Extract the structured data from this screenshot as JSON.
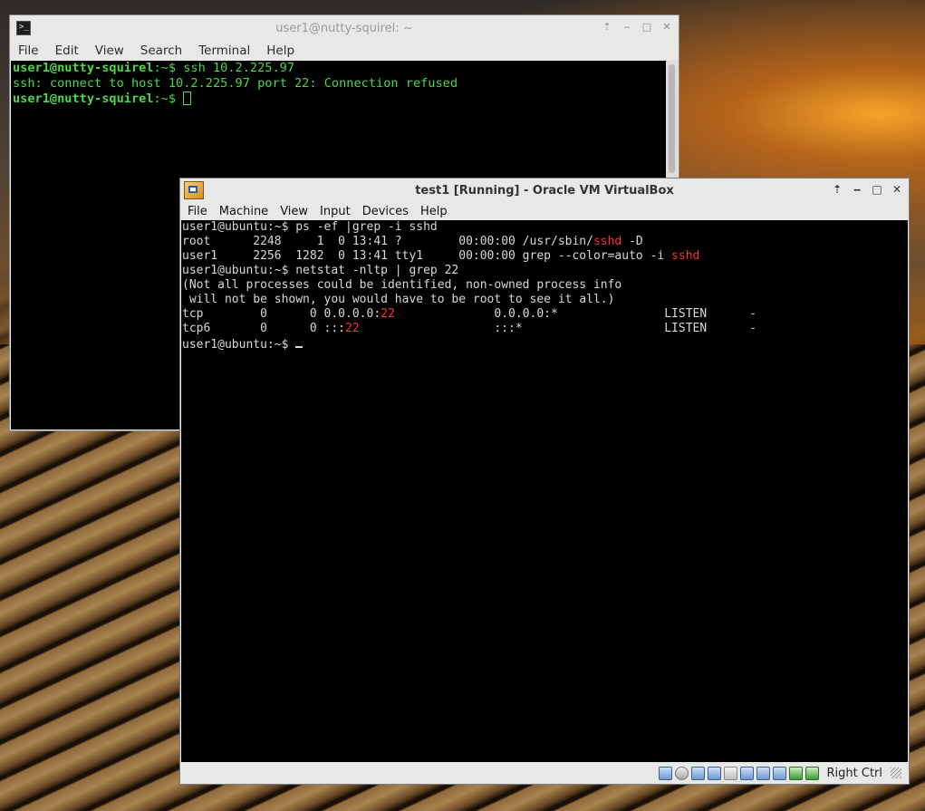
{
  "terminal": {
    "title": "user1@nutty-squirel: ~",
    "menu": [
      "File",
      "Edit",
      "View",
      "Search",
      "Terminal",
      "Help"
    ],
    "lines": [
      {
        "prompt": "user1@nutty-squirel",
        "path": ":~$",
        "cmd": " ssh 10.2.225.97"
      },
      {
        "text": "ssh: connect to host 10.2.225.97 port 22: Connection refused"
      },
      {
        "prompt": "user1@nutty-squirel",
        "path": ":~$",
        "cmd": " "
      }
    ]
  },
  "vbox": {
    "title": "test1 [Running] - Oracle VM VirtualBox",
    "menu": [
      "File",
      "Machine",
      "View",
      "Input",
      "Devices",
      "Help"
    ],
    "host_key": "Right Ctrl",
    "status_icons": [
      "hard-disk-icon",
      "optical-drive-icon",
      "network-icon",
      "usb-icon",
      "shared-folders-icon",
      "display-icon",
      "video-capture-icon",
      "mouse-integration-icon",
      "cpu-icon",
      "host-key-icon"
    ]
  },
  "vm_console": {
    "l1": "user1@ubuntu:~$ ps -ef |grep -i sshd",
    "l2a": "root      2248     1  0 13:41 ?        00:00:00 /usr/sbin/",
    "l2hl": "sshd",
    "l2b": " -D",
    "l3a": "user1     2256  1282  0 13:41 tty1     00:00:00 grep --color=auto -i ",
    "l3hl": "sshd",
    "l4": "user1@ubuntu:~$ netstat -nltp | grep 22",
    "l5": "(Not all processes could be identified, non-owned process info",
    "l6": " will not be shown, you would have to be root to see it all.)",
    "l7a": "tcp        0      0 0.0.0.0:",
    "l7hl": "22",
    "l7b": "              0.0.0.0:*               LISTEN      -",
    "l8a": "tcp6       0      0 :::",
    "l8hl": "22",
    "l8b": "                   :::*                    LISTEN      -",
    "l9": "user1@ubuntu:~$ "
  }
}
